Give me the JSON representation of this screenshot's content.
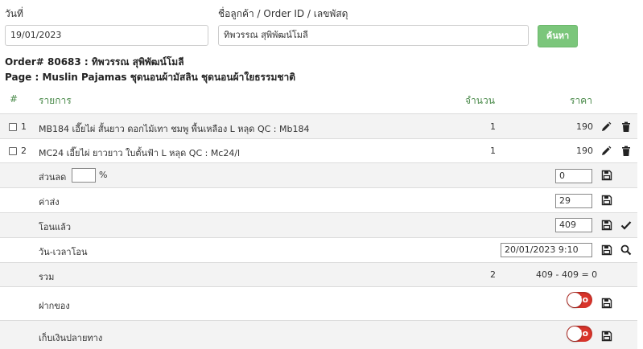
{
  "search": {
    "date_label": "วันที่",
    "date_value": "19/01/2023",
    "customer_label": "ชื่อลูกค้า / Order ID / เลขพัสดุ",
    "customer_value": "ทิพวรรณ สุพิพัฒน์โมลี",
    "search_button": "ค้นหา"
  },
  "order": {
    "title": "Order# 80683 : ทิพวรรณ สุพิพัฒน์โมลี",
    "page": "Page : Muslin Pajamas ชุดนอนผ้ามัสลิน ชุดนอนผ้าใยธรรมชาติ"
  },
  "table_header": {
    "num": "#",
    "item": "รายการ",
    "qty": "จำนวน",
    "price": "ราคา"
  },
  "items": [
    {
      "num": "1",
      "name": "MB184 เอี๊ยไผ่ สั้นยาว ดอกไม้เทา ชมพู พื้นเหลือง L หลุด QC : Mb184",
      "qty": "1",
      "price": "190"
    },
    {
      "num": "2",
      "name": "MC24 เอี๊ยไผ่ ยาวยาว ใบตั้นฟ้า L หลุด QC : Mc24/l",
      "qty": "1",
      "price": "190"
    }
  ],
  "discount": {
    "label": "ส่วนลด",
    "pct_value": "",
    "pct_sign": "%",
    "value": "0"
  },
  "shipping": {
    "label": "ค่าส่ง",
    "value": "29"
  },
  "paid": {
    "label": "โอนแล้ว",
    "value": "409"
  },
  "transfer_time": {
    "label": "วัน-เวลาโอน",
    "value": "20/01/2023 9:10"
  },
  "total": {
    "label": "รวม",
    "qty": "2",
    "summary": "409 - 409 = 0"
  },
  "deposit": {
    "label": "ฝากของ",
    "toggle": "No"
  },
  "cod": {
    "label": "เก็บเงินปลายทาง",
    "toggle": "No"
  },
  "colors": {
    "accent": "#7bc67b",
    "header_text": "#4a8a4a",
    "toggle_off": "#d9342b"
  }
}
